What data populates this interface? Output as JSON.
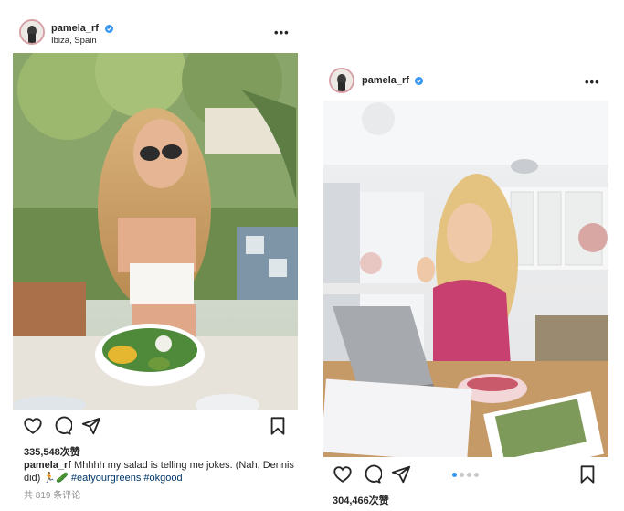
{
  "left_post": {
    "username": "pamela_rf",
    "location": "Ibiza, Spain",
    "more_label": "•••",
    "likes": "335,548次赞",
    "caption_user": "pamela_rf",
    "caption_text": "Mhhhh my salad is telling me jokes. (Nah, Dennis did)",
    "caption_emoji": "🏃🥒",
    "hashtag1": "#eatyourgreens",
    "hashtag2": "#okgood",
    "comments": "共 819 条评论"
  },
  "right_post": {
    "username": "pamela_rf",
    "more_label": "•••",
    "carousel_count": 4,
    "carousel_active_index": 0,
    "likes": "304,466次赞"
  },
  "colors": {
    "verified": "#3897f0",
    "hashtag": "#00376b",
    "avatar_ring": "#d7a0a6"
  },
  "icons": [
    "heart-icon",
    "comment-icon",
    "share-icon",
    "bookmark-icon",
    "more-icon",
    "verified-badge-icon"
  ]
}
